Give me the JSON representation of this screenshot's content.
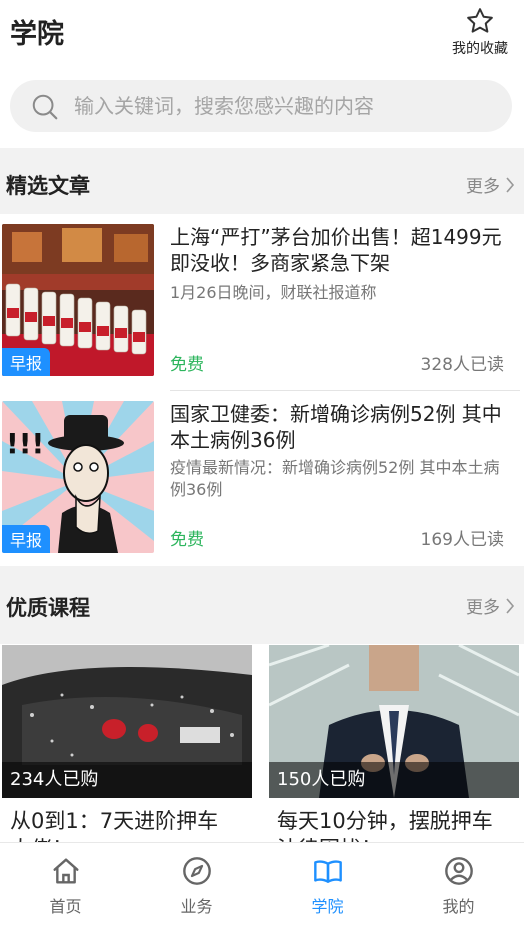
{
  "header": {
    "title": "学院",
    "favorites_label": "我的收藏"
  },
  "search": {
    "placeholder": "输入关键词，搜索您感兴趣的内容"
  },
  "articles_section": {
    "title": "精选文章",
    "more_label": "更多",
    "items": [
      {
        "title": "上海“严打”茅台加价出售！超1499元即没收！多商家紧急下架",
        "desc": "1月26日晚间，财联社报道称",
        "tag": "早报",
        "price": "免费",
        "reads": "328人已读"
      },
      {
        "title": "国家卫健委：新增确诊病例52例 其中本土病例36例",
        "desc": "疫情最新情况：新增确诊病例52例 其中本土病例36例",
        "tag": "早报",
        "price": "免费",
        "reads": "169人已读"
      }
    ]
  },
  "courses_section": {
    "title": "优质课程",
    "more_label": "更多",
    "items": [
      {
        "buyers": "234人已购",
        "title": "从0到1：7天进阶押车",
        "title_cont": "大佬！"
      },
      {
        "buyers": "150人已购",
        "title": "每天10分钟，摆脱押车",
        "title_cont": "法律困扰！"
      }
    ]
  },
  "tabbar": {
    "items": [
      {
        "label": "首页",
        "icon": "home-icon"
      },
      {
        "label": "业务",
        "icon": "compass-icon"
      },
      {
        "label": "学院",
        "icon": "book-icon"
      },
      {
        "label": "我的",
        "icon": "user-icon"
      }
    ],
    "active_index": 2
  },
  "colors": {
    "accent": "#1e90ff",
    "free": "#2db55d",
    "section_bg": "#f2f2f2"
  }
}
